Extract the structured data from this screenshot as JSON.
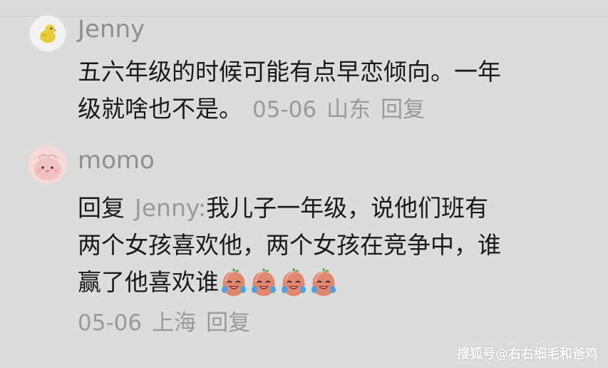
{
  "comments": [
    {
      "username": "Jenny",
      "avatar_icon": "chick-avatar-icon",
      "text_line1": "五六年级的时候可能有点早恋倾向。一年",
      "text_line2": "级就啥也不是。",
      "date": "05-06",
      "location": "山东",
      "reply_label": "回复"
    },
    {
      "username": "momo",
      "avatar_icon": "pink-face-avatar-icon",
      "reply_prefix": "回复",
      "reply_to": "Jenny:",
      "text_line1": "我儿子一年级，说他们班有",
      "text_line2": "两个女孩喜欢他，两个女孩在竞争中，谁",
      "text_line3": "赢了他喜欢谁",
      "emoji_icon": "laugh-cry-peach-icon",
      "emoji_count": 4,
      "date": "05-06",
      "location": "上海",
      "reply_label": "回复"
    }
  ],
  "watermark": "搜狐号@右右细毛和爸鸡",
  "colors": {
    "background": "#dcdcdc",
    "text": "#1a1a1a",
    "meta": "#9a9a9a"
  }
}
